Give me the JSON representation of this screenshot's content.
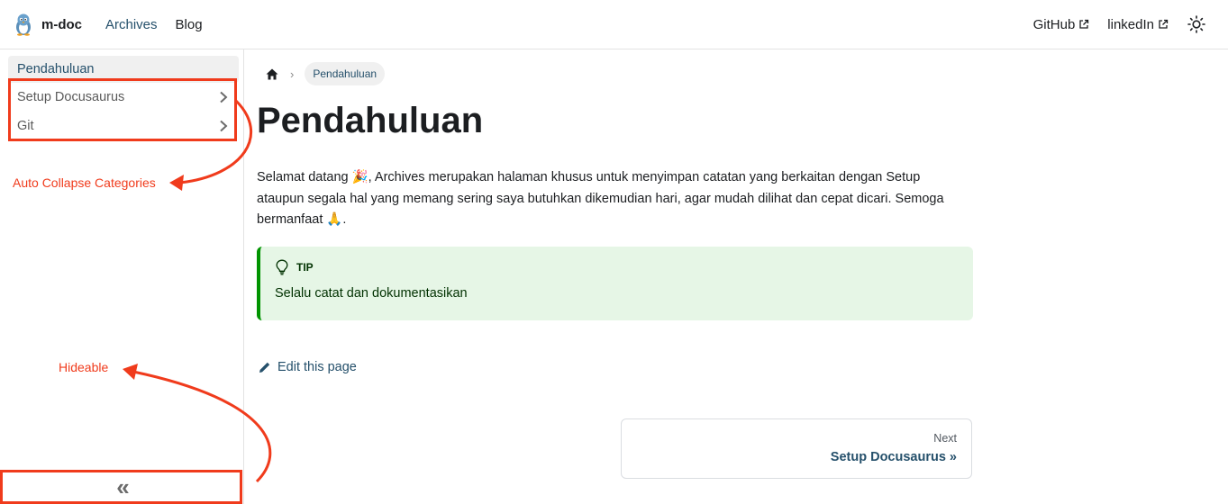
{
  "navbar": {
    "brand": "m-doc",
    "links": [
      "Archives",
      "Blog"
    ],
    "external": [
      "GitHub",
      "linkedIn"
    ]
  },
  "sidebar": {
    "active_item": "Pendahuluan",
    "categories": [
      "Setup Docusaurus",
      "Git"
    ],
    "collapse_glyph": "«"
  },
  "annotations": {
    "categories_note": "Auto Collapse Categories",
    "hide_note": "Hideable"
  },
  "breadcrumb": {
    "current": "Pendahuluan"
  },
  "main": {
    "title": "Pendahuluan",
    "intro": "Selamat datang 🎉, Archives merupakan halaman khusus untuk menyimpan catatan yang berkaitan dengan Setup ataupun segala hal yang memang sering saya butuhkan dikemudian hari, agar mudah dilihat dan cepat dicari. Semoga bermanfaat 🙏.",
    "tip_title": "TIP",
    "tip_body": "Selalu catat dan dokumentasikan",
    "edit_link": "Edit this page"
  },
  "pager": {
    "sublabel": "Next",
    "label": "Setup Docusaurus »"
  },
  "colors": {
    "accent": "#25506b",
    "annotation": "#f03b1c",
    "tip_bg": "#e6f6e6",
    "tip_border": "#009400"
  }
}
